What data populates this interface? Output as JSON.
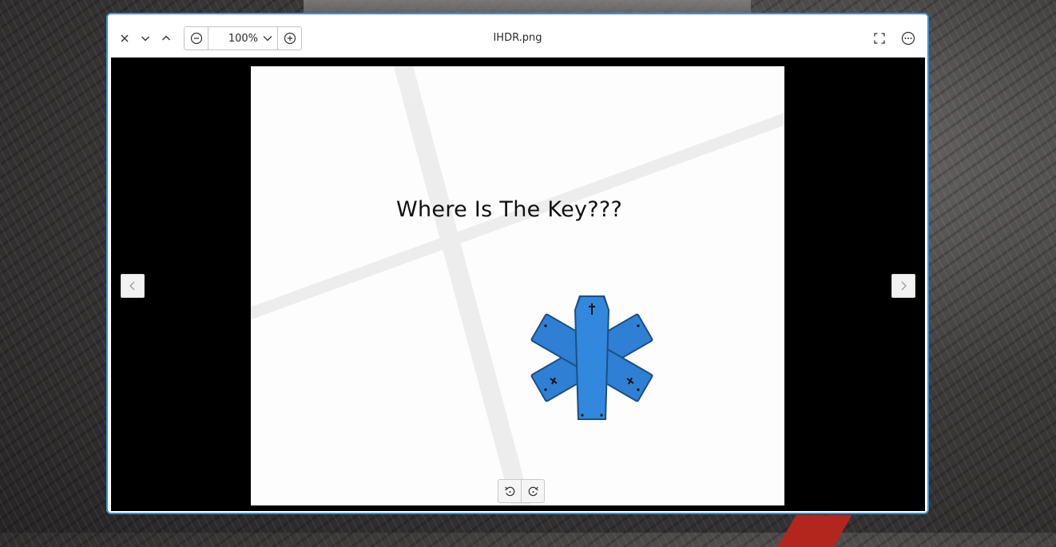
{
  "window": {
    "title": "IHDR.png"
  },
  "toolbar": {
    "close_icon": "close-icon",
    "next_icon": "chevron-down-icon",
    "prev_icon": "chevron-up-icon",
    "zoom_out_icon": "zoom-out-icon",
    "zoom_value": "100%",
    "zoom_dropdown_icon": "chevron-down-icon",
    "zoom_in_icon": "zoom-in-icon",
    "fullscreen_icon": "fullscreen-icon",
    "menu_icon": "more-options-icon"
  },
  "image": {
    "headline": "Where Is The Key???",
    "emblem": "blue-coffin-star-icon"
  },
  "navigation": {
    "previous_icon": "chevron-left-icon",
    "next_icon": "chevron-right-icon"
  },
  "rotate": {
    "rotate_left_icon": "rotate-left-icon",
    "rotate_right_icon": "rotate-right-icon"
  },
  "colors": {
    "accent": "#3d8fd6",
    "viewer_background": "#000000",
    "emblem_blue": "#2f7fd4"
  }
}
